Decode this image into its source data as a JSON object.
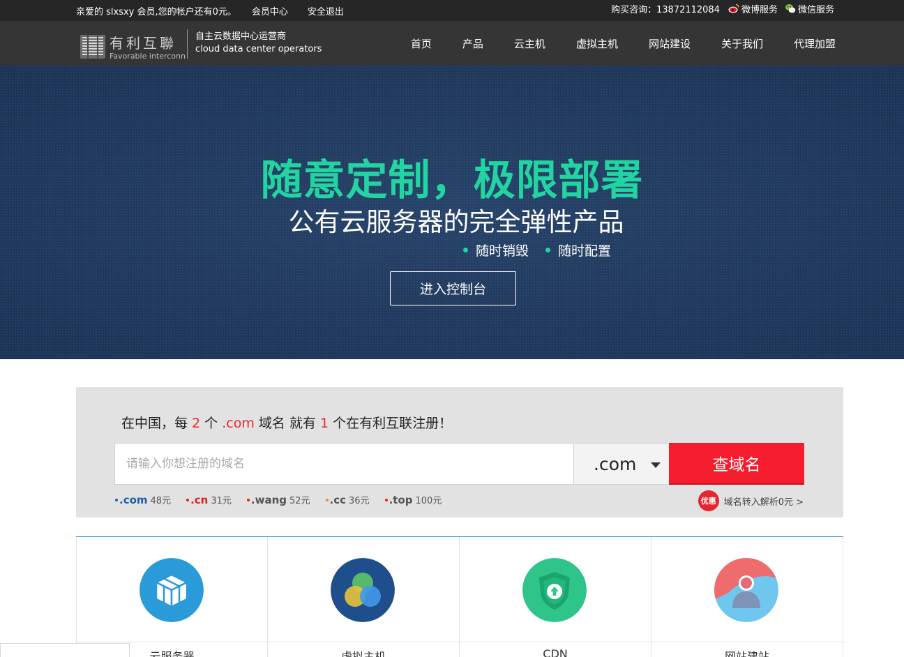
{
  "topbar": {
    "greeting": "亲爱的 slxsxy 会员,您的帐户还有0元。",
    "member_center": "会员中心",
    "logout": "安全退出",
    "consult": "购买咨询：13872112084",
    "weibo": "微博服务",
    "wechat": "微信服务"
  },
  "header": {
    "logo_cn": "有利互聯",
    "logo_en": "Favorable interconn",
    "slogan_cn": "自主云数据中心运营商",
    "slogan_en": "cloud data center operators",
    "nav": [
      "首页",
      "产品",
      "云主机",
      "虚拟主机",
      "网站建设",
      "关于我们",
      "代理加盟"
    ]
  },
  "hero": {
    "title": "随意定制，极限部署",
    "subtitle": "公有云服务器的完全弹性产品",
    "points": [
      "随时销毁",
      "随时配置"
    ],
    "button": "进入控制台",
    "accent": "#22d4a2"
  },
  "domain": {
    "headline": {
      "p1": "在中国，每 ",
      "n1": "2",
      "p2": " 个 ",
      "tld": ".com",
      "p3": " 域名 就有 ",
      "n2": "1",
      "p4": " 个在有利互联注册！"
    },
    "placeholder": "请输入你想注册的域名",
    "selected_tld": ".com",
    "search_button": "查域名",
    "prices": [
      {
        "tld": ".com",
        "price": "48元",
        "color": "#1e5fa8"
      },
      {
        "tld": ".cn",
        "price": "31元",
        "color": "#e02020"
      },
      {
        "tld": ".wang",
        "price": "52元",
        "color": "#555555"
      },
      {
        "tld": ".cc",
        "price": "36元",
        "color": "#555555"
      },
      {
        "tld": ".top",
        "price": "100元",
        "color": "#555555"
      }
    ],
    "promo_badge": "优惠",
    "promo_text": "域名转入解析0元 >",
    "accent": "#f51d2d"
  },
  "products": [
    {
      "label": "云服务器",
      "icon": "cube-icon",
      "color": "#2a9ad8"
    },
    {
      "label": "虚拟主机",
      "icon": "circles-icon",
      "color": "#1f4e8c"
    },
    {
      "label": "CDN",
      "icon": "shield-icon",
      "color": "#2fc58a"
    },
    {
      "label": "网站建站",
      "icon": "user-icon",
      "color": "#6fc7f0"
    }
  ]
}
